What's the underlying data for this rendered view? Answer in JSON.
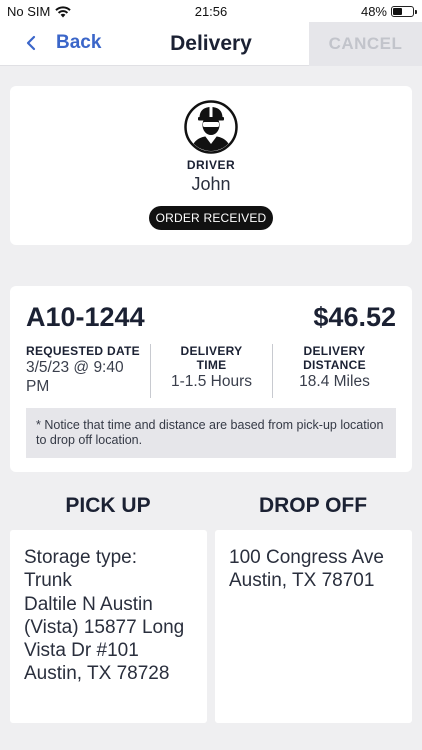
{
  "status_bar": {
    "carrier": "No SIM",
    "time": "21:56",
    "battery": "48%",
    "battery_level": 0.48
  },
  "nav": {
    "back_label": "Back",
    "title": "Delivery",
    "cancel_label": "CANCEL"
  },
  "driver": {
    "label": "DRIVER",
    "name": "John",
    "status": "ORDER RECEIVED"
  },
  "order": {
    "id": "A10-1244",
    "price": "$46.52",
    "requested_label": "REQUESTED DATE",
    "requested_value": "3/5/23 @ 9:40 PM",
    "time_label": "DELIVERY TIME",
    "time_value": "1-1.5 Hours",
    "distance_label": "DELIVERY DISTANCE",
    "distance_value": "18.4 Miles",
    "notice": "* Notice that time and distance are based from pick-up location to drop off location."
  },
  "pickup": {
    "title": "PICK UP",
    "storage_line1": "Storage type:",
    "storage_line2": "Trunk",
    "address": "Daltile N Austin (Vista) 15877 Long Vista Dr #101 Austin, TX 78728"
  },
  "dropoff": {
    "title": "DROP OFF",
    "address": "100 Congress Ave Austin, TX 78701"
  },
  "colors": {
    "accent": "#3b66c9",
    "text_dark": "#1b2133",
    "background": "#efeff1",
    "badge": "#111111"
  }
}
